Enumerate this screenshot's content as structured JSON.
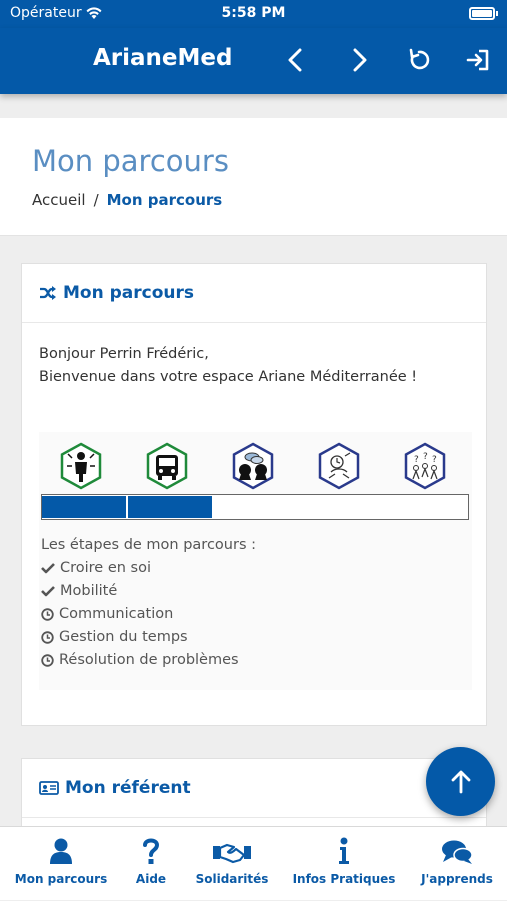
{
  "status_bar": {
    "carrier": "Opérateur",
    "time": "5:58 PM"
  },
  "navbar": {
    "title": "ArianeMed"
  },
  "header": {
    "title": "Mon parcours",
    "breadcrumb": {
      "home": "Accueil",
      "separator": "/",
      "current": "Mon parcours"
    }
  },
  "parcours_card": {
    "title": "Mon parcours",
    "greeting_line1": "Bonjour Perrin Frédéric,",
    "greeting_line2": "Bienvenue dans votre espace Ariane Méditerranée !",
    "progress_completed_steps": 2,
    "progress_total_steps": 5,
    "steps_title": "Les étapes de mon parcours :",
    "steps": [
      {
        "label": "Croire en soi",
        "status": "done",
        "icon": "check-icon"
      },
      {
        "label": "Mobilité",
        "status": "done",
        "icon": "check-icon"
      },
      {
        "label": "Communication",
        "status": "pending",
        "icon": "clock-icon"
      },
      {
        "label": "Gestion du temps",
        "status": "pending",
        "icon": "clock-icon"
      },
      {
        "label": "Résolution de problèmes",
        "status": "pending",
        "icon": "clock-icon"
      }
    ]
  },
  "referent_card": {
    "title": "Mon référent"
  },
  "tabbar": {
    "items": [
      {
        "label": "Mon parcours",
        "icon": "user-icon"
      },
      {
        "label": "Aide",
        "icon": "question-icon"
      },
      {
        "label": "Solidarités",
        "icon": "handshake-icon"
      },
      {
        "label": "Infos Pratiques",
        "icon": "info-icon"
      },
      {
        "label": "J'apprends",
        "icon": "chat-icon"
      }
    ]
  },
  "colors": {
    "primary": "#0459a8",
    "accent_text": "#0b5aa6",
    "title_light": "#5a8ec2",
    "step_done_hex": "#1f8a3a",
    "step_pending_hex": "#2a3a8c"
  }
}
